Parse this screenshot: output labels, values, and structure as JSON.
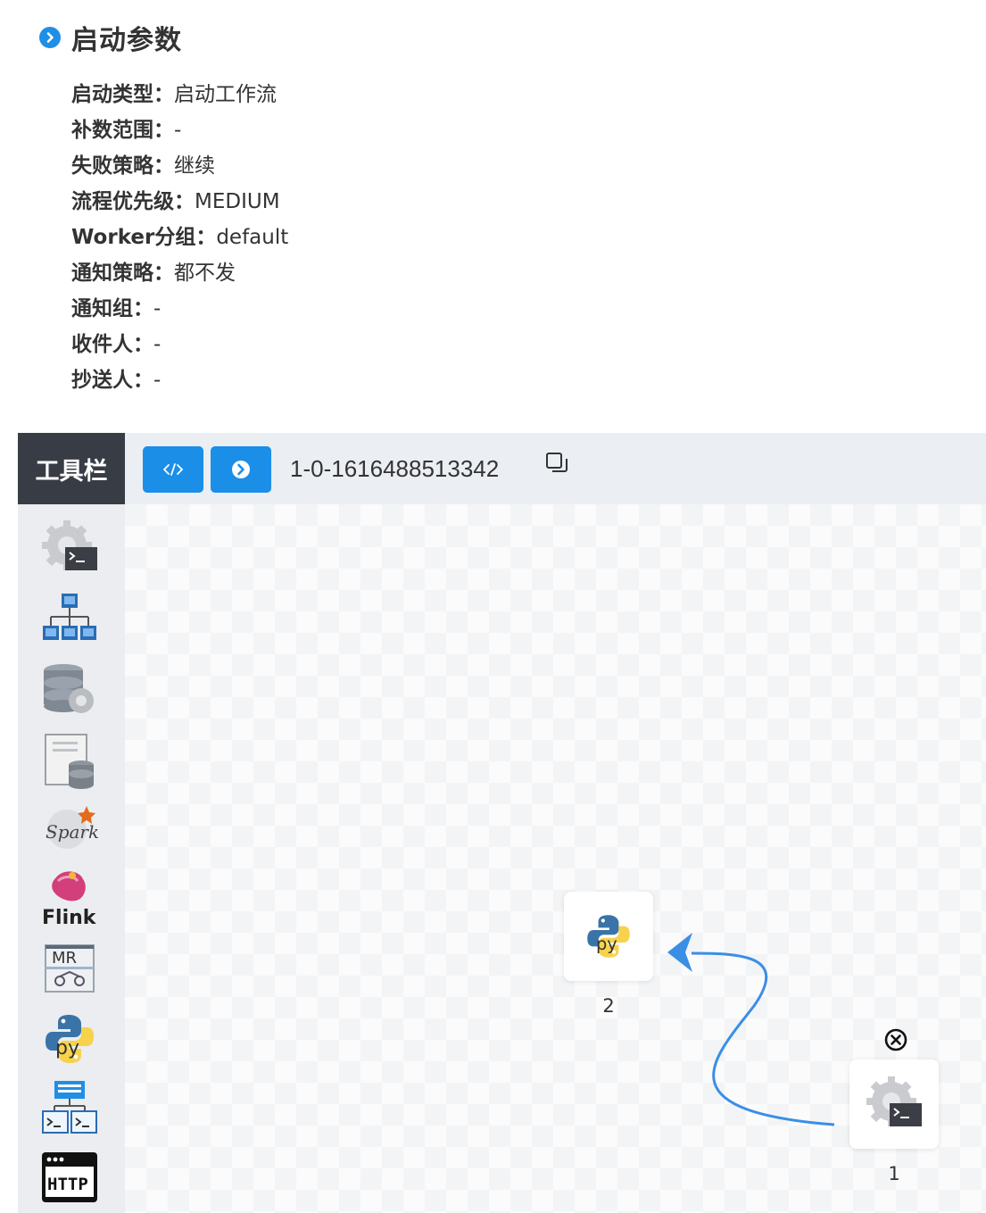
{
  "section": {
    "title": "启动参数"
  },
  "params": [
    {
      "key": "启动类型：",
      "value": "启动工作流"
    },
    {
      "key": "补数范围：",
      "value": "-"
    },
    {
      "key": "失败策略：",
      "value": "继续"
    },
    {
      "key": "流程优先级：",
      "value": "MEDIUM"
    },
    {
      "key": "Worker分组：",
      "value": "default"
    },
    {
      "key": "通知策略：",
      "value": "都不发"
    },
    {
      "key": "通知组：",
      "value": "-"
    },
    {
      "key": "收件人：",
      "value": "-"
    },
    {
      "key": "抄送人：",
      "value": "-"
    }
  ],
  "toolbar": {
    "title": "工具栏",
    "tools": [
      {
        "icon": "shell-task-icon"
      },
      {
        "icon": "sub-process-task-icon"
      },
      {
        "icon": "procedure-task-icon"
      },
      {
        "icon": "sql-task-icon"
      },
      {
        "icon": "spark-task-icon",
        "text": "Spark"
      },
      {
        "icon": "flink-task-icon",
        "text": "Flink"
      },
      {
        "icon": "mr-task-icon",
        "text": "MR"
      },
      {
        "icon": "python-task-icon"
      },
      {
        "icon": "dependent-task-icon"
      },
      {
        "icon": "http-task-icon",
        "text": "HTTP"
      }
    ]
  },
  "topbar": {
    "instance_name": "1-0-1616488513342",
    "buttons": [
      {
        "icon": "code-icon"
      },
      {
        "icon": "chevron-right-circle-icon"
      }
    ]
  },
  "nodes": [
    {
      "label": "2",
      "icon": "python-task-icon"
    },
    {
      "label": "1",
      "icon": "shell-task-icon"
    }
  ],
  "colors": {
    "accent": "#1b8ee8",
    "toolbar_dark": "#383c44",
    "edge": "#3a8ee6"
  }
}
